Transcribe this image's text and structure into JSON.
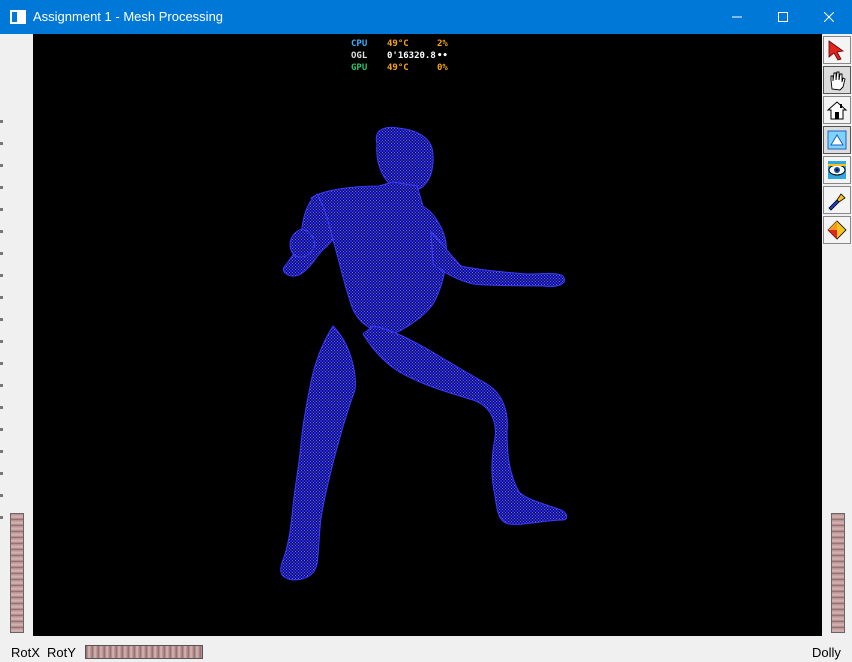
{
  "window": {
    "title": "Assignment 1 - Mesh Processing",
    "controls": {
      "minimize": "—",
      "maximize": "☐",
      "close": "✕"
    }
  },
  "hud": {
    "rows": [
      {
        "label": "CPU",
        "v1": "49°C",
        "v2": "2%",
        "label_color": "#3ab0ff",
        "value_color": "#f6a31b"
      },
      {
        "label": "OGL",
        "v1": "0'16320.8",
        "v2": "••",
        "label_color": "#e0e0e0",
        "value_color": "#ffffff"
      },
      {
        "label": "GPU",
        "v1": "49°C",
        "v2": "0%",
        "label_color": "#29c36a",
        "value_color": "#f6a31b"
      }
    ]
  },
  "toolbar": {
    "tools": [
      {
        "name": "select-arrow-icon"
      },
      {
        "name": "pan-hand-icon"
      },
      {
        "name": "home-view-icon"
      },
      {
        "name": "fit-view-icon",
        "active": true
      },
      {
        "name": "eye-view-icon"
      },
      {
        "name": "flashlight-icon"
      },
      {
        "name": "shading-cube-icon"
      }
    ]
  },
  "bottom": {
    "rotx_label": "RotX",
    "roty_label": "RotY",
    "dolly_label": "Dolly"
  },
  "colors": {
    "titlebar": "#0078d7",
    "mesh": "#2a2aff",
    "viewport_bg": "#000000"
  }
}
